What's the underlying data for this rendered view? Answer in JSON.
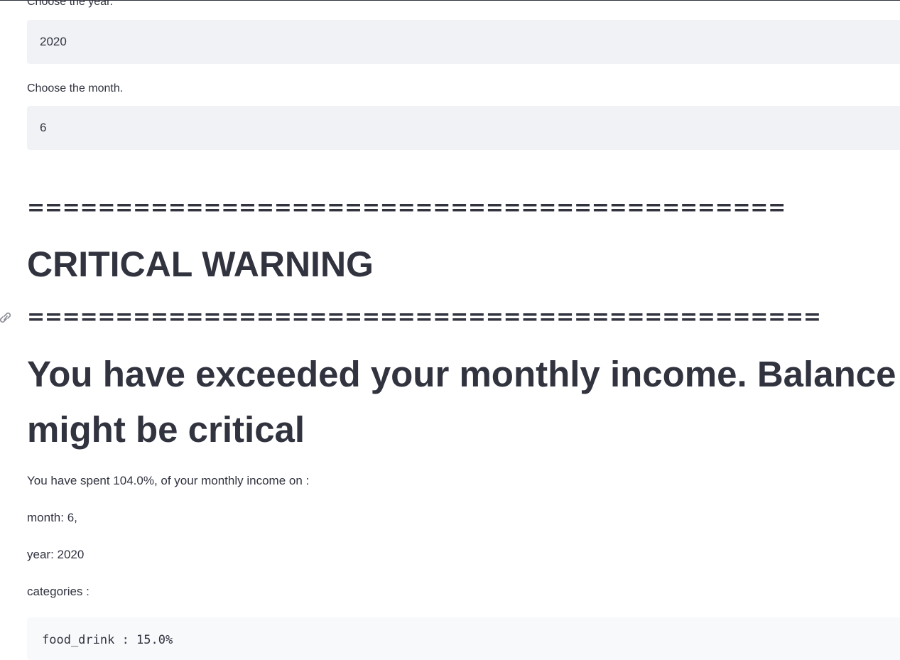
{
  "form": {
    "year_label": "Choose the year.",
    "year_value": "2020",
    "month_label": "Choose the month.",
    "month_value": "6"
  },
  "warning": {
    "separator_top": "===========================================",
    "title": "CRITICAL WARNING",
    "separator_bottom": "=============================================",
    "headline": "You have exceeded your monthly income. Balance might be critical"
  },
  "report": {
    "spent_text": "You have spent 104.0%, of your monthly income on :",
    "month_text": "month: 6,",
    "year_text": "year: 2020",
    "categories_label": "categories :",
    "categories": [
      "food_drink : 15.0%"
    ]
  },
  "icons": {
    "anchor": "link-icon"
  }
}
